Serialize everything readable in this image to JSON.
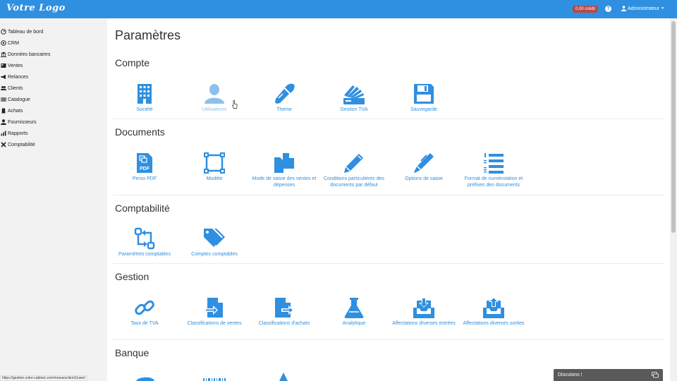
{
  "header": {
    "logo": "Votre Logo",
    "credit": "0,00 crédit",
    "help_icon": "question-icon",
    "user": "Administrateur",
    "brand_color": "#2f8fe0"
  },
  "sidebar": {
    "items": [
      {
        "label": "Tableau de bord",
        "icon": "dashboard-icon"
      },
      {
        "label": "CRM",
        "icon": "crm-icon"
      },
      {
        "label": "Données bancaires",
        "icon": "bank-icon"
      },
      {
        "label": "Ventes",
        "icon": "sales-icon"
      },
      {
        "label": "Relances",
        "icon": "megaphone-icon"
      },
      {
        "label": "Clients",
        "icon": "users-icon"
      },
      {
        "label": "Catalogue",
        "icon": "barcode-icon"
      },
      {
        "label": "Achats",
        "icon": "cart-icon"
      },
      {
        "label": "Fournisseurs",
        "icon": "user-icon"
      },
      {
        "label": "Rapports",
        "icon": "chart-icon"
      },
      {
        "label": "Comptabilité",
        "icon": "tools-icon"
      }
    ]
  },
  "main": {
    "title": "Paramètres",
    "sections": [
      {
        "title": "Compte",
        "tiles": [
          {
            "label": "Société",
            "icon": "building-icon"
          },
          {
            "label": "Utilisateurs",
            "icon": "user-icon"
          },
          {
            "label": "Theme",
            "icon": "eyedropper-icon"
          },
          {
            "label": "Gestion TVA",
            "icon": "swatches-icon"
          },
          {
            "label": "Sauvegarde",
            "icon": "floppy-icon"
          }
        ]
      },
      {
        "title": "Documents",
        "tiles": [
          {
            "label": "Perso PDF",
            "icon": "pdf-icon"
          },
          {
            "label": "Modèle",
            "icon": "vector-square-icon"
          },
          {
            "label": "Mode de saisie des ventes et dépenses",
            "icon": "copy-icon"
          },
          {
            "label": "Conditions particulières des documents par défaut",
            "icon": "pencil-icon"
          },
          {
            "label": "Options de saisie",
            "icon": "pen-icon"
          },
          {
            "label": "Format de numérotation et préfixes des documents",
            "icon": "numbered-list-icon"
          }
        ]
      },
      {
        "title": "Comptabilité",
        "tiles": [
          {
            "label": "Paramètres comptables",
            "icon": "swap-icon"
          },
          {
            "label": "Comptes comptables",
            "icon": "tags-icon"
          }
        ]
      },
      {
        "title": "Gestion",
        "tiles": [
          {
            "label": "Taux de TVA",
            "icon": "link-icon"
          },
          {
            "label": "Classifications de ventes",
            "icon": "file-import-icon"
          },
          {
            "label": "Classifications d'achats",
            "icon": "file-export-icon"
          },
          {
            "label": "Analytique",
            "icon": "flask-icon"
          },
          {
            "label": "Affectations diverses entrées",
            "icon": "tray-in-icon"
          },
          {
            "label": "Affectations diverses sorties",
            "icon": "tray-out-icon"
          }
        ]
      },
      {
        "title": "Banque",
        "tiles": []
      }
    ]
  },
  "status_bar": {
    "url": "https://gestion.votre-cabinet.com/mesuesclient1/user/"
  },
  "chat": {
    "label": "Discutons !",
    "icon": "chat-icon"
  }
}
